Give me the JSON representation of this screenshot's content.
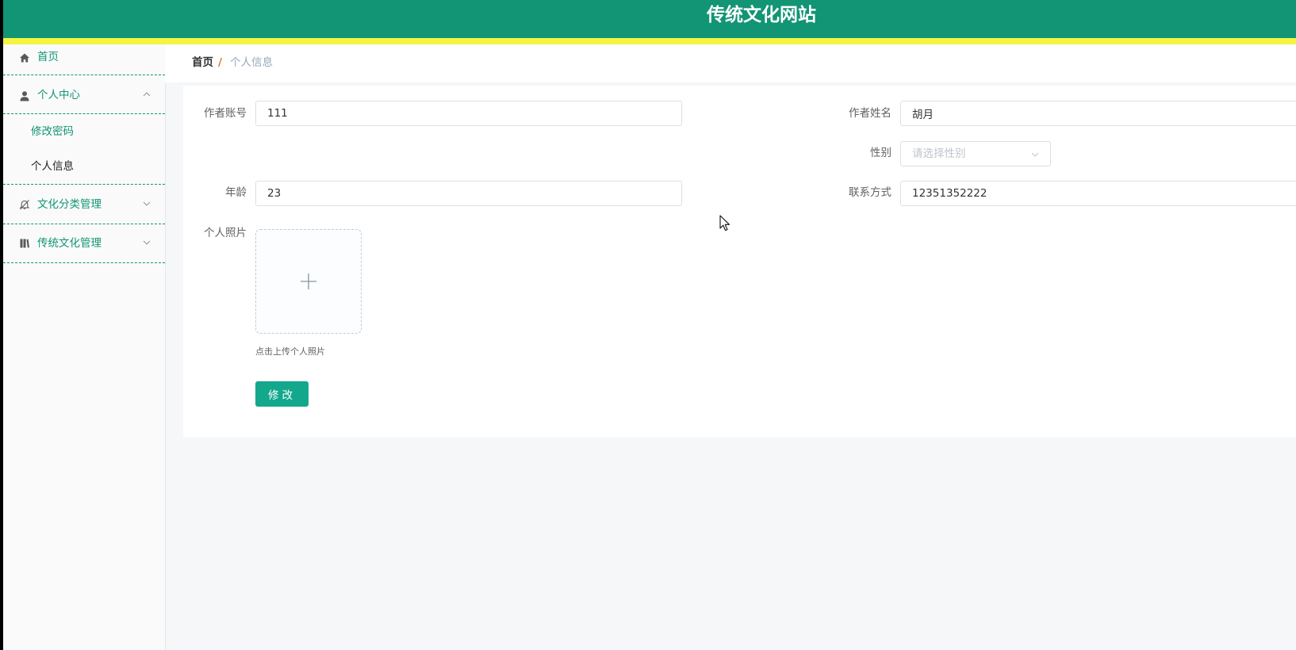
{
  "header": {
    "title": "传统文化网站",
    "bg_color": "#119574",
    "stripe_color": "#f4f441"
  },
  "sidebar": {
    "items": [
      {
        "label": "首页",
        "icon": "home-icon"
      },
      {
        "label": "个人中心",
        "icon": "user-icon",
        "expanded": true,
        "children": [
          {
            "label": "修改密码",
            "active": false
          },
          {
            "label": "个人信息",
            "active": true
          }
        ]
      },
      {
        "label": "文化分类管理",
        "icon": "bell-off-icon",
        "expanded": false
      },
      {
        "label": "传统文化管理",
        "icon": "book-icon",
        "expanded": false
      }
    ],
    "accent_color": "#119574"
  },
  "breadcrumb": {
    "home": "首页",
    "separator": "/",
    "current": "个人信息"
  },
  "form": {
    "account": {
      "label": "作者账号",
      "value": "111"
    },
    "name": {
      "label": "作者姓名",
      "value": "胡月"
    },
    "gender": {
      "label": "性别",
      "placeholder": "请选择性别"
    },
    "age": {
      "label": "年龄",
      "value": "23"
    },
    "contact": {
      "label": "联系方式",
      "value": "12351352222"
    },
    "photo": {
      "label": "个人照片",
      "tip": "点击上传个人照片"
    },
    "submit_label": "修改",
    "button_color": "#13a88c"
  }
}
